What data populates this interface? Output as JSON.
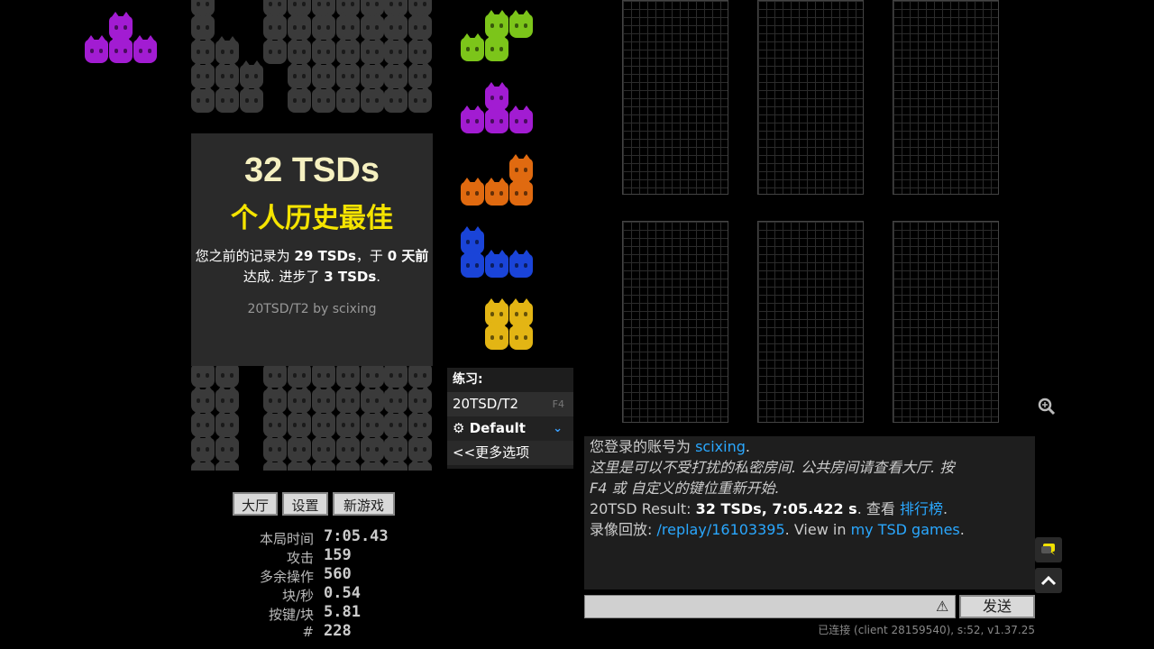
{
  "overlay": {
    "score": "32 TSDs",
    "personal_best": "个人历史最佳",
    "prev_prefix": "您之前的记录为 ",
    "prev_score": "29 TSDs",
    "prev_mid": "，于 ",
    "prev_days": "0 天前",
    "prev_suffix": " 达成. 进步了 ",
    "improve": "3 TSDs",
    "improve_end": ".",
    "mode_by": "20TSD/T2 by scixing"
  },
  "practice": {
    "title": "练习:",
    "mode": "20TSD/T2",
    "mode_key": "F4",
    "default": "Default",
    "more": "<<更多选项"
  },
  "buttons": {
    "lobby": "大厅",
    "settings": "设置",
    "new_game": "新游戏"
  },
  "stats": [
    {
      "label": "本局时间",
      "value": "7:05.43"
    },
    {
      "label": "攻击",
      "value": "159"
    },
    {
      "label": "多余操作",
      "value": "560"
    },
    {
      "label": "块/秒",
      "value": "0.54"
    },
    {
      "label": "按键/块",
      "value": "5.81"
    },
    {
      "label": "#",
      "value": "228"
    }
  ],
  "chat": {
    "l1_a": "您登录的账号为 ",
    "l1_user": "scixing",
    "l1_end": ".",
    "l2": "这里是可以不受打扰的私密房间. 公共房间请查看大厅. 按",
    "l3": "F4 或 自定义的键位重新开始.",
    "l4_a": "20TSD Result: ",
    "l4_b": "32 TSDs, 7:05.422 s",
    "l4_c": ". 查看 ",
    "l4_link": "排行榜",
    "l4_end": ".",
    "l5_a": "录像回放: ",
    "l5_link": "/replay/16103395",
    "l5_b": ". View in ",
    "l5_link2": "my TSD games",
    "l5_end": "."
  },
  "send_label": "发送",
  "status": "已连接 (client 28159540), s:52, v1.37.25",
  "colors": {
    "purple": "#a21cd2",
    "green": "#7cc51a",
    "orange": "#e06a10",
    "blue": "#1a44d8",
    "yellow": "#e3b514",
    "gray": "#3a3a3a",
    "link": "#2aa8ff",
    "pb": "#f5e400"
  },
  "icons": {
    "gear": "gear-icon",
    "chevron": "chevron-down-icon",
    "warning": "warning-icon",
    "zoom": "zoom-icon",
    "chat": "chat-icon",
    "up": "chevron-up-icon"
  }
}
